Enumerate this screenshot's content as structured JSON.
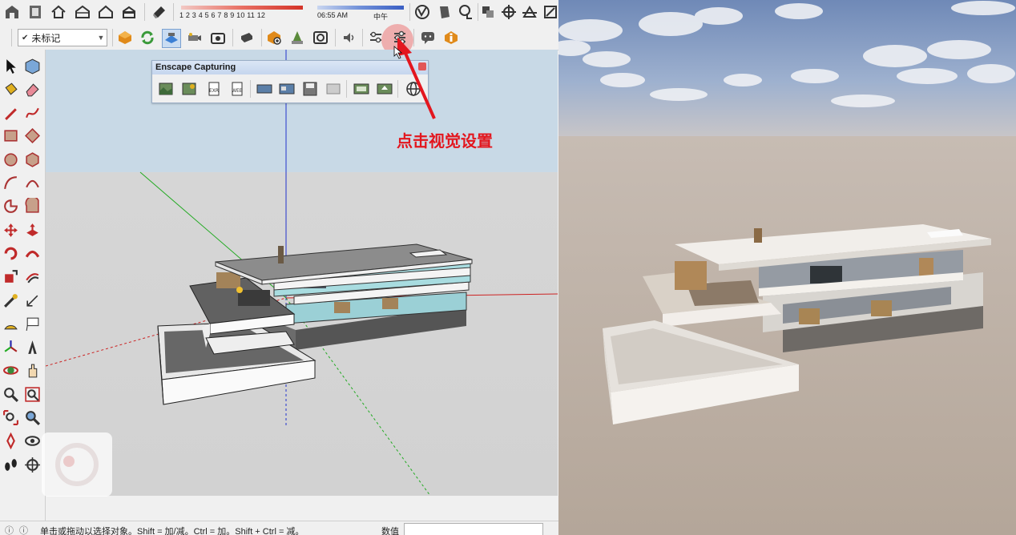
{
  "colors": {
    "annotation_red": "#e3161e",
    "sky_top": "#6f89b7",
    "ground": "#b8aa9f",
    "viewport_ground": "#d4d4d4"
  },
  "toolbar_top": {
    "shadow_scale_numbers": "1 2 3 4 5 6 7 8 9 10 11 12",
    "time_start": "06:55 AM",
    "time_mid": "中午"
  },
  "toolbar_second": {
    "tag_select_value": "未标记"
  },
  "enscape_panel": {
    "title": "Enscape Capturing"
  },
  "annotation": {
    "text": "点击视觉设置",
    "target_icon": "visual-settings-icon"
  },
  "status_bar": {
    "message": "单击或拖动以选择对象。Shift = 加/减。Ctrl = 加。Shift + Ctrl = 减。",
    "measure_label": "数值",
    "measure_value": ""
  },
  "icons": {
    "palette": [
      "select-arrow-icon",
      "make-component-icon",
      "paint-bucket-icon",
      "eraser-icon",
      "pencil-line-icon",
      "freehand-icon",
      "rectangle-icon",
      "rotated-rectangle-icon",
      "circle-icon",
      "polygon-icon",
      "arc-icon",
      "arc-3point-icon",
      "pie-icon",
      "arc-2point-icon",
      "move-icon",
      "push-pull-icon",
      "rotate-icon",
      "follow-me-icon",
      "scale-icon",
      "offset-icon",
      "tape-measure-icon",
      "dimension-icon",
      "protractor-icon",
      "text-icon",
      "axes-icon",
      "3d-text-icon",
      "orbit-icon",
      "pan-icon",
      "zoom-icon",
      "zoom-window-icon",
      "zoom-extents-icon",
      "previous-view-icon",
      "position-camera-icon",
      "look-around-icon",
      "walk-icon",
      "section-plane-icon"
    ]
  }
}
